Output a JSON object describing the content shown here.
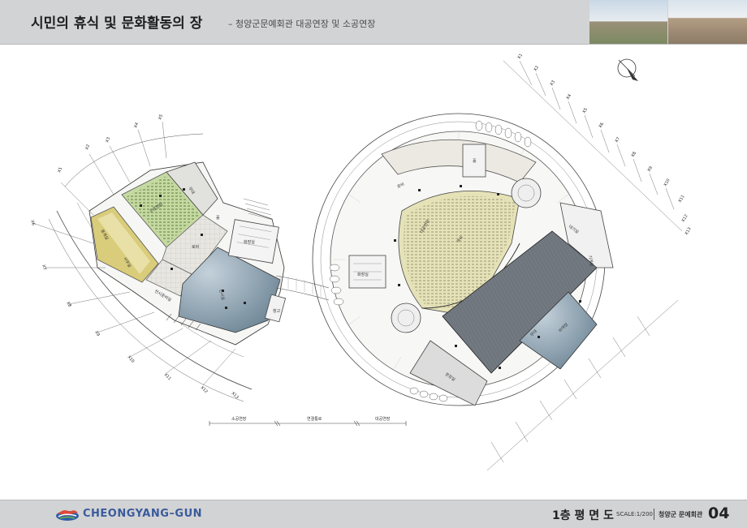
{
  "header": {
    "title": "시민의 휴식 및 문화활동의 장",
    "subtitle": "– 청양군문예회관 대공연장 및 소공연장"
  },
  "plan": {
    "left_building": {
      "rooms": [
        "소공연장",
        "무대",
        "휴게실",
        "사무실",
        "로비",
        "전시실",
        "전시준비실",
        "화장실",
        "홀",
        "창고"
      ]
    },
    "right_building": {
      "rooms": [
        "대공연장",
        "무대",
        "객석",
        "로비",
        "화장실",
        "분장실",
        "대기실",
        "하역장",
        "기계실",
        "홀"
      ]
    },
    "connector_labels": [
      "소공연장",
      "연결통로",
      "대공연장"
    ],
    "grid_left": [
      "X1",
      "X2",
      "X3",
      "X4",
      "X5",
      "X6",
      "X7",
      "X8",
      "X9",
      "X10",
      "X11",
      "X12",
      "X13"
    ],
    "grid_right": [
      "X1",
      "X2",
      "X3",
      "X4",
      "X5",
      "X6",
      "X7",
      "X8",
      "X9",
      "X10",
      "X11",
      "X12",
      "X13"
    ]
  },
  "footer": {
    "brand": "CHEONGYANG–GUN",
    "plan_title": "1층 평 면 도",
    "scale": "SCALE:1/200",
    "client": "청양군 문예회관",
    "page_number": "04"
  },
  "colors": {
    "header_bg": "#d2d3d5",
    "auditorium": "#e6e2b8",
    "small_hall": "#c5d9a2",
    "exhibit": "#8fa3b2",
    "stage": "#6f757d",
    "lobby_tile": "#e5e3df",
    "lounge": "#d9cc7a"
  },
  "icons": {
    "north_arrow": "north-arrow-icon",
    "logo": "cheongyang-logo-icon"
  }
}
